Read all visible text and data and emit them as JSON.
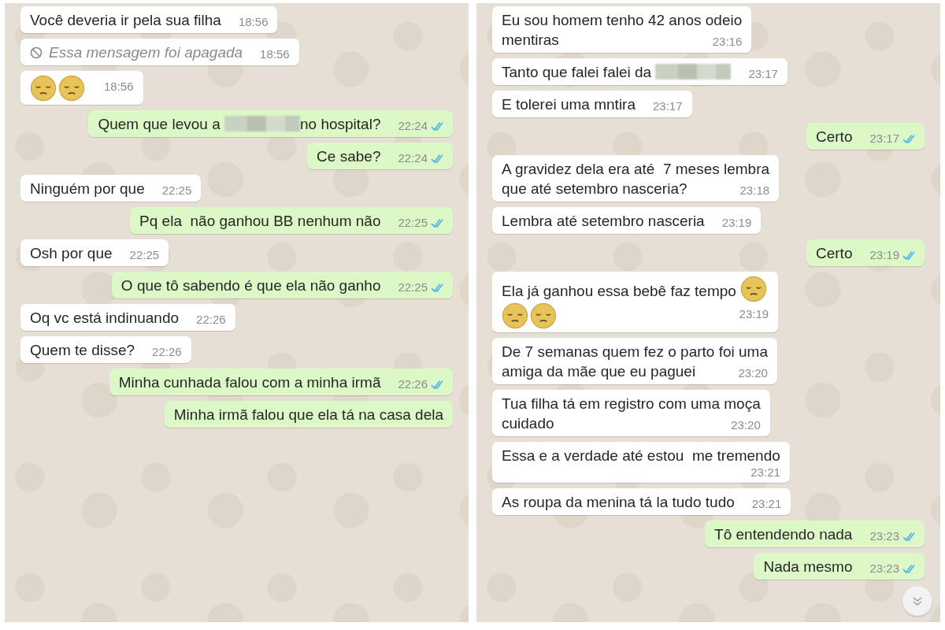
{
  "panels": [
    {
      "messages": [
        {
          "outgoing": false,
          "parts": [
            {
              "kind": "text",
              "text": "Você deveria ir pela sua filha"
            }
          ],
          "time": "18:56"
        },
        {
          "outgoing": false,
          "parts": [
            {
              "kind": "deleted",
              "text": "Essa mensagem foi apagada"
            }
          ],
          "time": "18:56"
        },
        {
          "outgoing": false,
          "parts": [
            {
              "kind": "emoji"
            },
            {
              "kind": "emoji"
            }
          ],
          "time": "18:56"
        },
        {
          "outgoing": true,
          "parts": [
            {
              "kind": "text",
              "text": "Quem que levou a "
            },
            {
              "kind": "redacted"
            },
            {
              "kind": "text",
              "text": "no hospital?"
            }
          ],
          "time": "22:24",
          "read": true
        },
        {
          "outgoing": true,
          "parts": [
            {
              "kind": "text",
              "text": "Ce sabe?"
            }
          ],
          "time": "22:24",
          "read": true
        },
        {
          "outgoing": false,
          "parts": [
            {
              "kind": "text",
              "text": "Ninguém por que"
            }
          ],
          "time": "22:25"
        },
        {
          "outgoing": true,
          "parts": [
            {
              "kind": "text",
              "text": "Pq ela  não ganhou BB nenhum não"
            }
          ],
          "time": "22:25",
          "read": true
        },
        {
          "outgoing": false,
          "parts": [
            {
              "kind": "text",
              "text": "Osh por que"
            }
          ],
          "time": "22:25"
        },
        {
          "outgoing": true,
          "parts": [
            {
              "kind": "text",
              "text": "O que tô sabendo é que ela não ganho"
            }
          ],
          "time": "22:25",
          "read": true
        },
        {
          "outgoing": false,
          "parts": [
            {
              "kind": "text",
              "text": "Oq vc está indinuando"
            }
          ],
          "time": "22:26"
        },
        {
          "outgoing": false,
          "parts": [
            {
              "kind": "text",
              "text": "Quem te disse?"
            }
          ],
          "time": "22:26"
        },
        {
          "outgoing": true,
          "parts": [
            {
              "kind": "text",
              "text": "Minha cunhada falou com a minha irmã"
            }
          ],
          "time": "22:26",
          "read": true
        },
        {
          "outgoing": true,
          "parts": [
            {
              "kind": "text",
              "text": "Minha irmã falou que ela tá na casa dela"
            }
          ]
        }
      ]
    },
    {
      "messages": [
        {
          "outgoing": false,
          "parts": [
            {
              "kind": "text",
              "text": "Eu sou homem tenho 42 anos odeio"
            },
            {
              "kind": "break"
            },
            {
              "kind": "text",
              "text": "mentiras"
            }
          ],
          "time": "23:16"
        },
        {
          "outgoing": false,
          "parts": [
            {
              "kind": "text",
              "text": "Tanto que falei falei da "
            },
            {
              "kind": "redacted"
            }
          ],
          "time": "23:17"
        },
        {
          "outgoing": false,
          "parts": [
            {
              "kind": "text",
              "text": "E tolerei uma mntira"
            }
          ],
          "time": "23:17"
        },
        {
          "outgoing": true,
          "parts": [
            {
              "kind": "text",
              "text": "Certo"
            }
          ],
          "time": "23:17",
          "read": true
        },
        {
          "outgoing": false,
          "parts": [
            {
              "kind": "text",
              "text": "A gravidez dela era até  7 meses lembra"
            },
            {
              "kind": "break"
            },
            {
              "kind": "text",
              "text": "que até setembro nasceria?"
            }
          ],
          "time": "23:18"
        },
        {
          "outgoing": false,
          "parts": [
            {
              "kind": "text",
              "text": "Lembra até setembro nasceria"
            }
          ],
          "time": "23:19"
        },
        {
          "outgoing": true,
          "parts": [
            {
              "kind": "text",
              "text": "Certo"
            }
          ],
          "time": "23:19",
          "read": true
        },
        {
          "outgoing": false,
          "parts": [
            {
              "kind": "text",
              "text": "Ela já ganhou essa bebê faz tempo "
            },
            {
              "kind": "emoji"
            },
            {
              "kind": "break"
            },
            {
              "kind": "emoji"
            },
            {
              "kind": "emoji"
            }
          ],
          "time": "23:19"
        },
        {
          "outgoing": false,
          "parts": [
            {
              "kind": "text",
              "text": "De 7 semanas quem fez o parto foi uma"
            },
            {
              "kind": "break"
            },
            {
              "kind": "text",
              "text": "amiga da mãe que eu paguei"
            }
          ],
          "time": "23:20"
        },
        {
          "outgoing": false,
          "parts": [
            {
              "kind": "text",
              "text": "Tua filha tá em registro com uma moça"
            },
            {
              "kind": "break"
            },
            {
              "kind": "text",
              "text": "cuidado"
            }
          ],
          "time": "23:20"
        },
        {
          "outgoing": false,
          "time_below": true,
          "parts": [
            {
              "kind": "text",
              "text": "Essa e a verdade até estou  me tremendo"
            }
          ],
          "time": "23:21"
        },
        {
          "outgoing": false,
          "parts": [
            {
              "kind": "text",
              "text": "As roupa da menina tá la tudo tudo"
            }
          ],
          "time": "23:21"
        },
        {
          "outgoing": true,
          "parts": [
            {
              "kind": "text",
              "text": "Tô entendendo nada"
            }
          ],
          "time": "23:23",
          "read": true
        },
        {
          "outgoing": true,
          "parts": [
            {
              "kind": "text",
              "text": "Nada mesmo"
            }
          ],
          "time": "23:23",
          "read": true
        }
      ],
      "scroll_button": true
    }
  ]
}
